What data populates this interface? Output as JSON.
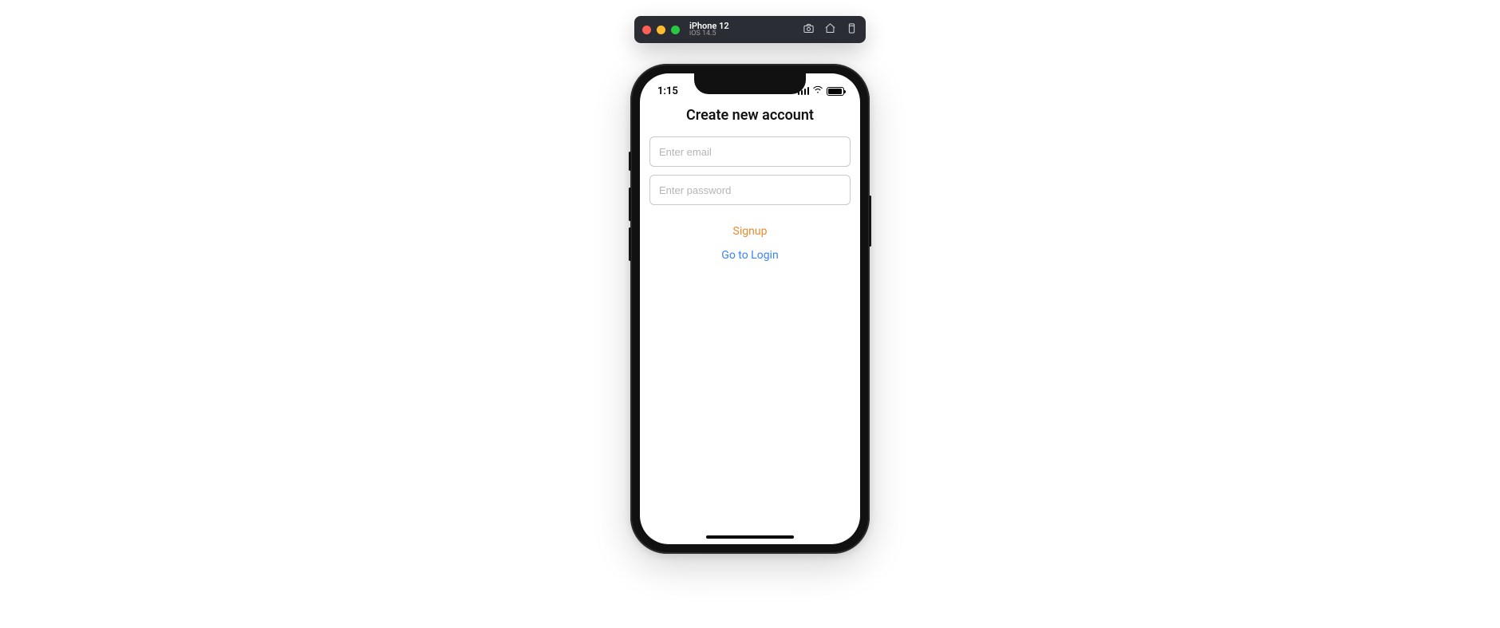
{
  "simulator": {
    "device_name": "iPhone 12",
    "os_version": "iOS 14.5"
  },
  "status": {
    "time": "1:15"
  },
  "screen": {
    "title": "Create new account",
    "email_placeholder": "Enter email",
    "email_value": "",
    "password_placeholder": "Enter password",
    "password_value": "",
    "signup_label": "Signup",
    "login_label": "Go to Login"
  }
}
